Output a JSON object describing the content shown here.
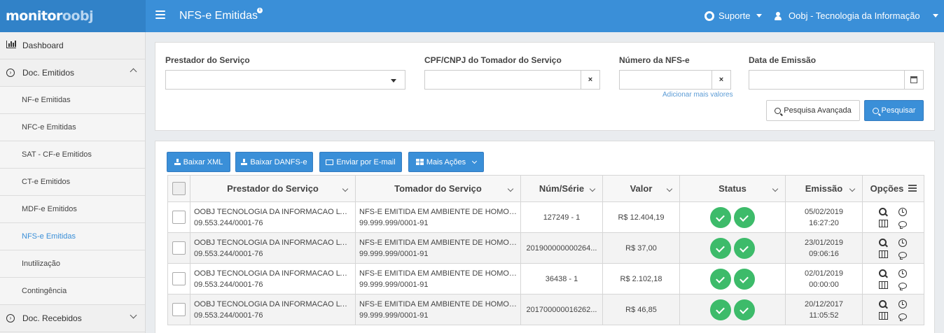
{
  "app": {
    "logo_part1": "monitor",
    "logo_part2": "oobj",
    "page_title": "NFS-e Emitidas",
    "title_badge": "i",
    "support_label": "Suporte",
    "user_label": "Oobj - Tecnologia da Informação",
    "accent_color": "#3a8fd8",
    "success_color": "#3dbb6a"
  },
  "sidebar": {
    "items": [
      {
        "label": "Dashboard",
        "icon": "bar-chart-icon",
        "type": "top"
      },
      {
        "label": "Doc. Emitidos",
        "icon": "circle-arrow-icon",
        "type": "top",
        "expanded": true
      },
      {
        "label": "NF-e Emitidas",
        "type": "sub"
      },
      {
        "label": "NFC-e Emitidas",
        "type": "sub"
      },
      {
        "label": "SAT - CF-e Emitidos",
        "type": "sub"
      },
      {
        "label": "CT-e Emitidos",
        "type": "sub"
      },
      {
        "label": "MDF-e Emitidos",
        "type": "sub"
      },
      {
        "label": "NFS-e Emitidas",
        "type": "sub",
        "active": true
      },
      {
        "label": "Inutilização",
        "type": "sub"
      },
      {
        "label": "Contingência",
        "type": "sub"
      },
      {
        "label": "Doc. Recebidos",
        "icon": "circle-arrow-icon",
        "type": "top",
        "expanded": false
      }
    ]
  },
  "filters": {
    "prestador_label": "Prestador do Serviço",
    "prestador_value": "",
    "cpf_label": "CPF/CNPJ do Tomador do Serviço",
    "cpf_value": "",
    "numero_label": "Número da NFS-e",
    "numero_value": "",
    "add_more_link": "Adicionar mais valores",
    "data_label": "Data de Emissão",
    "data_value": "",
    "clear_symbol": "×",
    "advanced_search": "Pesquisa Avançada",
    "search": "Pesquisar"
  },
  "actions": {
    "baixar_xml": "Baixar XML",
    "baixar_danfse": "Baixar DANFS-e",
    "enviar_email": "Enviar por E-mail",
    "mais_acoes": "Mais Ações"
  },
  "table": {
    "columns": {
      "prestador": "Prestador do Serviço",
      "tomador": "Tomador do Serviço",
      "numserie": "Núm/Série",
      "valor": "Valor",
      "status": "Status",
      "emissao": "Emissão",
      "opcoes": "Opções"
    },
    "rows": [
      {
        "prestador_nome": "OOBJ TECNOLOGIA DA INFORMACAO LTDA",
        "prestador_cnpj": "09.553.244/0001-76",
        "tomador_nome": "NFS-E EMITIDA EM AMBIENTE DE HOMOLOGACAO - SEM VALOR FISCAL",
        "tomador_cnpj": "99.999.999/0001-91",
        "numserie": "127249 - 1",
        "valor": "R$ 12.404,19",
        "emissao_data": "05/02/2019",
        "emissao_hora": "16:27:20"
      },
      {
        "prestador_nome": "OOBJ TECNOLOGIA DA INFORMACAO LTDA",
        "prestador_cnpj": "09.553.244/0001-76",
        "tomador_nome": "NFS-E EMITIDA EM AMBIENTE DE HOMOLOGACAO - SEM VALOR FISCAL",
        "tomador_cnpj": "99.999.999/0001-91",
        "numserie": "201900000000264...",
        "valor": "R$ 37,00",
        "emissao_data": "23/01/2019",
        "emissao_hora": "09:06:16"
      },
      {
        "prestador_nome": "OOBJ TECNOLOGIA DA INFORMACAO LTDA",
        "prestador_cnpj": "09.553.244/0001-76",
        "tomador_nome": "NFS-E EMITIDA EM AMBIENTE DE HOMOLOGACAO - SEM VALOR FISCAL",
        "tomador_cnpj": "99.999.999/0001-91",
        "numserie": "36438 - 1",
        "valor": "R$ 2.102,18",
        "emissao_data": "02/01/2019",
        "emissao_hora": "00:00:00"
      },
      {
        "prestador_nome": "OOBJ TECNOLOGIA DA INFORMACAO LTDA",
        "prestador_cnpj": "09.553.244/0001-76",
        "tomador_nome": "NFS-E EMITIDA EM AMBIENTE DE HOMOLOGACAO - SEM VALOR FISCAL",
        "tomador_cnpj": "99.999.999/0001-91",
        "numserie": "201700000016262...",
        "valor": "R$ 46,85",
        "emissao_data": "20/12/2017",
        "emissao_hora": "11:05:52"
      }
    ]
  }
}
